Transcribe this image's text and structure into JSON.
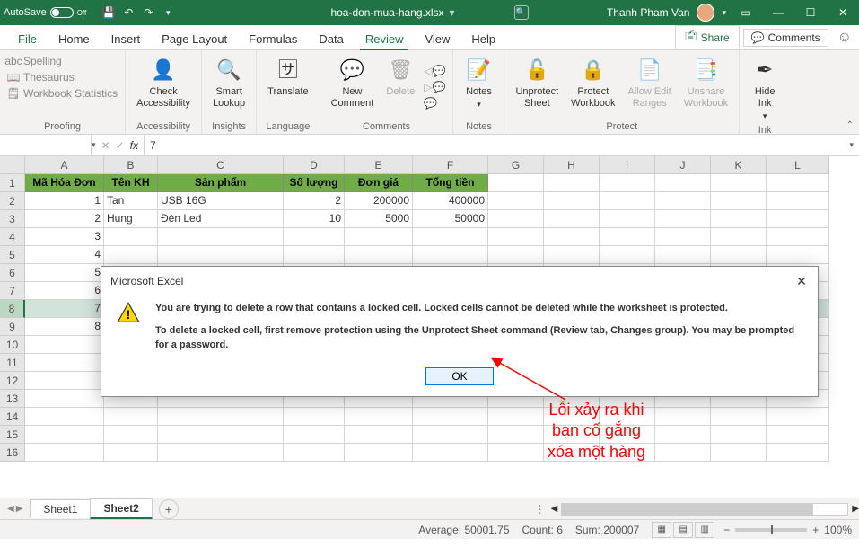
{
  "title": {
    "autosave": "AutoSave",
    "autosave_state": "Off",
    "filename": "hoa-don-mua-hang.xlsx",
    "saved": "",
    "search_placeholder": "Search",
    "user": "Thanh Pham Van"
  },
  "tabs": [
    "File",
    "Home",
    "Insert",
    "Page Layout",
    "Formulas",
    "Data",
    "Review",
    "View",
    "Help"
  ],
  "active_tab": "Review",
  "share": "Share",
  "comments_btn": "Comments",
  "ribbon": {
    "proofing": {
      "spelling": "Spelling",
      "thesaurus": "Thesaurus",
      "stats": "Workbook Statistics",
      "label": "Proofing"
    },
    "accessibility": {
      "btn": "Check\nAccessibility",
      "label": "Accessibility"
    },
    "insights": {
      "btn": "Smart\nLookup",
      "label": "Insights"
    },
    "language": {
      "btn": "Translate",
      "label": "Language"
    },
    "comments": {
      "new": "New\nComment",
      "delete": "Delete",
      "prev": "",
      "next": "",
      "show": "",
      "label": "Comments"
    },
    "notes": {
      "btn": "Notes",
      "label": "Notes"
    },
    "protect": {
      "unprotect": "Unprotect\nSheet",
      "workbook": "Protect\nWorkbook",
      "ranges": "Allow Edit\nRanges",
      "unshare": "Unshare\nWorkbook",
      "label": "Protect"
    },
    "ink": {
      "btn": "Hide\nInk",
      "label": "Ink"
    }
  },
  "formula": {
    "namebox": "",
    "fx": "fx",
    "value": "7"
  },
  "columns": [
    "A",
    "B",
    "C",
    "D",
    "E",
    "F",
    "G",
    "H",
    "I",
    "J",
    "K",
    "L"
  ],
  "headers": [
    "Mã Hóa Đơn",
    "Tên KH",
    "Sản phẩm",
    "Số lượng",
    "Đơn giá",
    "Tổng tiền"
  ],
  "data_rows": [
    {
      "n": 1,
      "a": "1",
      "b": "Tan",
      "c": "USB 16G",
      "d": "2",
      "e": "200000",
      "f": "400000"
    },
    {
      "n": 2,
      "a": "2",
      "b": "Hung",
      "c": "Đèn Led",
      "d": "10",
      "e": "5000",
      "f": "50000"
    }
  ],
  "remaining_a": [
    "3",
    "4",
    "5",
    "6",
    "7",
    "8"
  ],
  "selected_row": 8,
  "dialog": {
    "title": "Microsoft Excel",
    "line1": "You are trying to delete a row that contains a locked cell. Locked cells cannot be deleted while the worksheet is protected.",
    "line2": "To delete a locked cell, first remove protection using the Unprotect Sheet command (Review tab, Changes group). You may be prompted for a password.",
    "ok": "OK"
  },
  "annotation": "Lỗi xảy ra khi\nbạn cố gắng\nxóa một hàng",
  "sheets": [
    "Sheet1",
    "Sheet2"
  ],
  "active_sheet": 1,
  "status": {
    "average": "Average: 50001.75",
    "count": "Count: 6",
    "sum": "Sum: 200007",
    "zoom": "100%"
  }
}
